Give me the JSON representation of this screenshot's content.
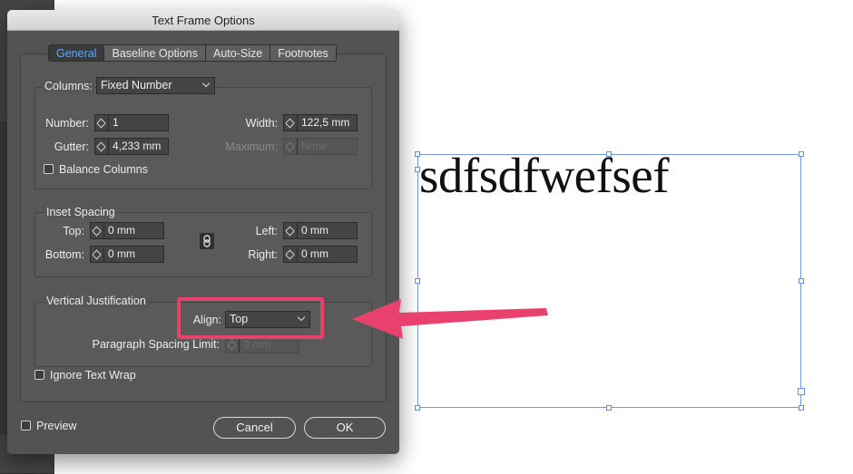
{
  "dialog": {
    "title": "Text Frame Options",
    "tabs": [
      {
        "label": "General",
        "active": true
      },
      {
        "label": "Baseline Options",
        "active": false
      },
      {
        "label": "Auto-Size",
        "active": false
      },
      {
        "label": "Footnotes",
        "active": false
      }
    ],
    "columns": {
      "label": "Columns:",
      "type_value": "Fixed Number",
      "number_label": "Number:",
      "number_value": "1",
      "gutter_label": "Gutter:",
      "gutter_value": "4,233 mm",
      "width_label": "Width:",
      "width_value": "122,5 mm",
      "maximum_label": "Maximum:",
      "maximum_value": "None",
      "balance_label": "Balance Columns",
      "balance_checked": false
    },
    "inset": {
      "title": "Inset Spacing",
      "top_label": "Top:",
      "top_value": "0 mm",
      "bottom_label": "Bottom:",
      "bottom_value": "0 mm",
      "left_label": "Left:",
      "left_value": "0 mm",
      "right_label": "Right:",
      "right_value": "0 mm"
    },
    "vertical": {
      "title": "Vertical Justification",
      "align_label": "Align:",
      "align_value": "Top",
      "spacing_label": "Paragraph Spacing Limit:",
      "spacing_value": "0 mm"
    },
    "ignore_wrap_label": "Ignore Text Wrap",
    "preview_label": "Preview",
    "cancel_label": "Cancel",
    "ok_label": "OK"
  },
  "canvas": {
    "frame_text": "sdfsdfwefsef"
  },
  "colors": {
    "highlight": "#e8416e",
    "active_tab_text": "#59a9ff",
    "frame_border": "#7a9ae0"
  }
}
